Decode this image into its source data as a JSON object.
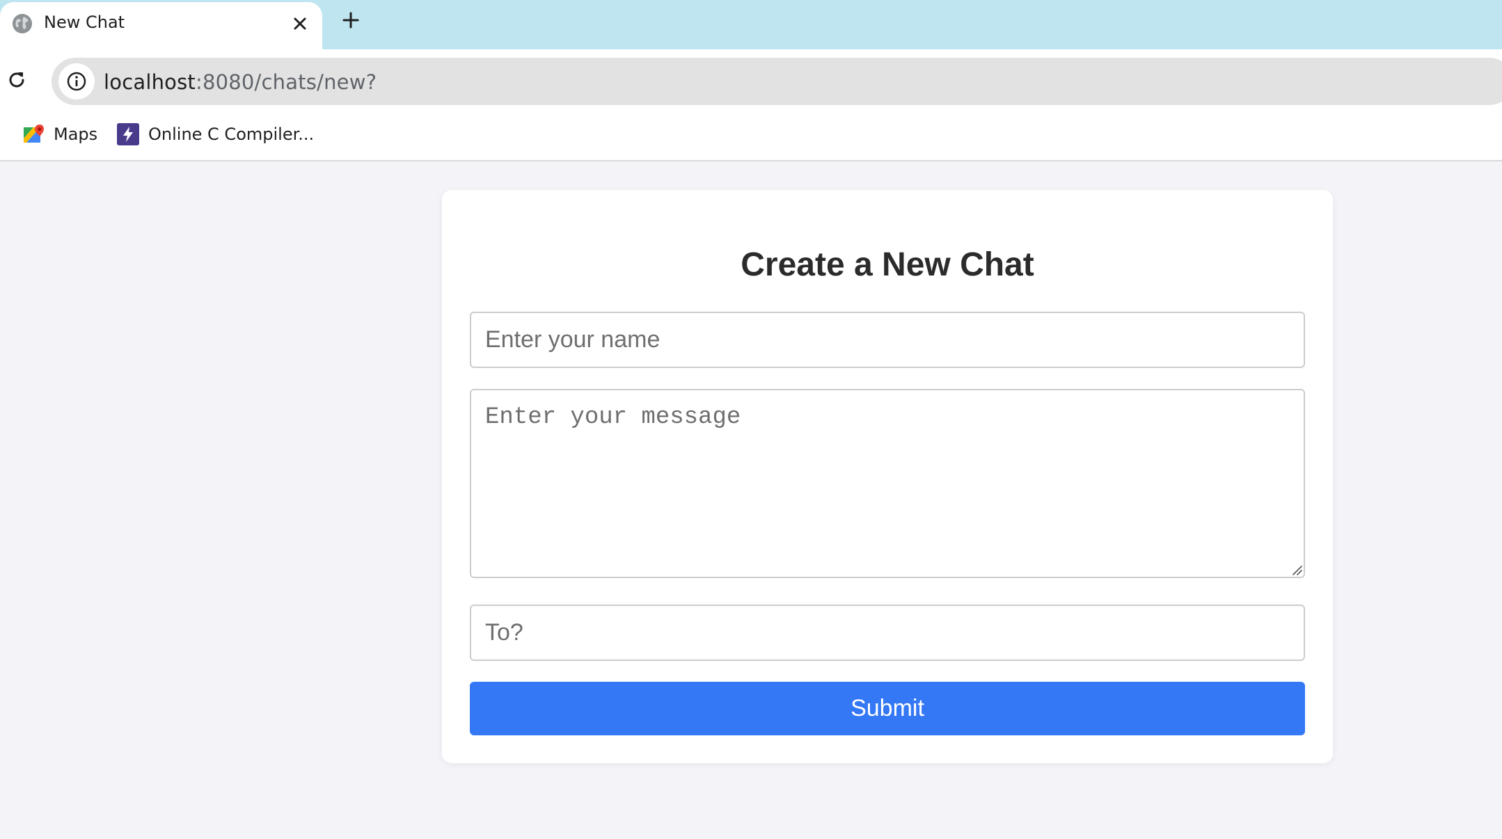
{
  "browser": {
    "tab": {
      "title": "New Chat",
      "icon": "globe-icon",
      "close_icon": "close-icon"
    },
    "new_tab_icon": "plus-icon",
    "reload_icon": "reload-icon",
    "address": {
      "host": "localhost",
      "path": ":8080/chats/new?",
      "info_icon": "info-icon"
    },
    "bookmarks": [
      {
        "label": "Maps",
        "icon": "maps-icon"
      },
      {
        "label": "Online C Compiler...",
        "icon": "bolt-icon"
      }
    ]
  },
  "form": {
    "title": "Create a New Chat",
    "name_placeholder": "Enter your name",
    "message_placeholder": "Enter your message",
    "to_placeholder": "To?",
    "submit_label": "Submit"
  },
  "colors": {
    "tab_strip": "#bfe5f0",
    "page_background": "#f4f4f8",
    "submit_button": "#3478f6",
    "compiler_icon": "#4a3a8c"
  }
}
